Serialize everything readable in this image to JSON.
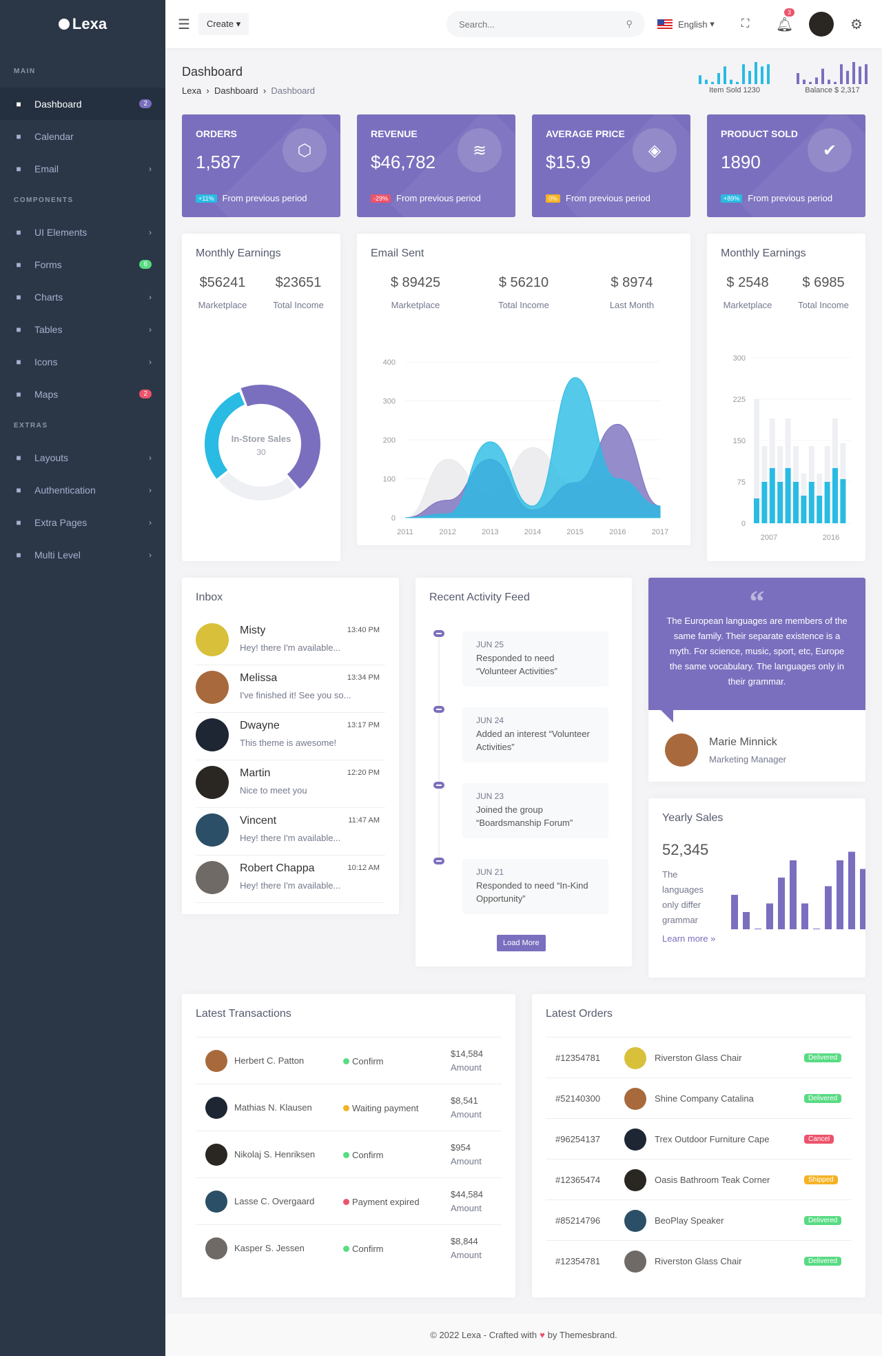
{
  "brand": {
    "name": "Lexa"
  },
  "sidebar": {
    "sections": [
      "MAIN",
      "COMPONENTS",
      "EXTRAS"
    ],
    "items": [
      {
        "label": "Dashboard",
        "icon": "dashboard-icon",
        "badge": "2",
        "badge_color": "#7a6fbe",
        "active": true
      },
      {
        "label": "Calendar",
        "icon": "calendar-icon"
      },
      {
        "label": "Email",
        "icon": "email-icon",
        "chevron": true
      },
      {
        "label": "UI Elements",
        "icon": "layers-icon",
        "chevron": true
      },
      {
        "label": "Forms",
        "icon": "clipboard-icon",
        "badge": "6",
        "badge_color": "#58db83"
      },
      {
        "label": "Charts",
        "icon": "chart-line-icon",
        "chevron": true
      },
      {
        "label": "Tables",
        "icon": "list-icon",
        "chevron": true
      },
      {
        "label": "Icons",
        "icon": "record-icon",
        "chevron": true
      },
      {
        "label": "Maps",
        "icon": "map-marker-icon",
        "badge": "2",
        "badge_color": "#ec536c"
      },
      {
        "label": "Layouts",
        "icon": "laptop-icon",
        "chevron": true
      },
      {
        "label": "Authentication",
        "icon": "account-box-icon",
        "chevron": true
      },
      {
        "label": "Extra Pages",
        "icon": "pages-icon",
        "chevron": true
      },
      {
        "label": "Multi Level",
        "icon": "share-icon",
        "chevron": true
      }
    ]
  },
  "topbar": {
    "create_label": "Create",
    "search_placeholder": "Search...",
    "language": "English",
    "notification_count": "3"
  },
  "page": {
    "title": "Dashboard",
    "breadcrumb": [
      "Lexa",
      "Dashboard",
      "Dashboard"
    ],
    "sparklines": [
      {
        "label": "Item Sold 1230",
        "color": "#29bbe3",
        "values": [
          4,
          2,
          1,
          5,
          8,
          2,
          1,
          9,
          6,
          10,
          8,
          9
        ]
      },
      {
        "label": "Balance $ 2,317",
        "color": "#7a6fbe",
        "values": [
          5,
          2,
          1,
          3,
          7,
          2,
          1,
          9,
          6,
          10,
          8,
          9
        ]
      }
    ]
  },
  "stats": [
    {
      "title": "ORDERS",
      "value": "1,587",
      "change": "+11%",
      "change_color": "#29bbe3",
      "footer": "From previous period",
      "icon": "cube-icon"
    },
    {
      "title": "REVENUE",
      "value": "$46,782",
      "change": "-29%",
      "change_color": "#ec536c",
      "footer": "From previous period",
      "icon": "layers-icon"
    },
    {
      "title": "AVERAGE PRICE",
      "value": "$15.9",
      "change": "0%",
      "change_color": "#f5b225",
      "footer": "From previous period",
      "icon": "tag-icon"
    },
    {
      "title": "PRODUCT SOLD",
      "value": "1890",
      "change": "+89%",
      "change_color": "#29bbe3",
      "footer": "From previous period",
      "icon": "briefcase-check-icon"
    }
  ],
  "earnings1": {
    "title": "Monthly Earnings",
    "kpis": [
      {
        "value": "$56241",
        "label": "Marketplace"
      },
      {
        "value": "$23651",
        "label": "Total Income"
      }
    ],
    "donut_label": "In-Store Sales",
    "donut_value": "30"
  },
  "email": {
    "title": "Email Sent",
    "kpis": [
      {
        "value": "$ 89425",
        "label": "Marketplace"
      },
      {
        "value": "$ 56210",
        "label": "Total Income"
      },
      {
        "value": "$ 8974",
        "label": "Last Month"
      }
    ]
  },
  "earnings2": {
    "title": "Monthly Earnings",
    "kpis": [
      {
        "value": "$ 2548",
        "label": "Marketplace"
      },
      {
        "value": "$ 6985",
        "label": "Total Income"
      }
    ]
  },
  "chart_data": [
    {
      "type": "pie",
      "variant": "donut",
      "title": "In-Store Sales",
      "slices": [
        {
          "value": 45,
          "color": "#7a6fbe"
        },
        {
          "value": 25,
          "color": "#eef0f4"
        },
        {
          "value": 30,
          "color": "#29bbe3"
        }
      ]
    },
    {
      "type": "area",
      "x": [
        "2011",
        "2012",
        "2013",
        "2014",
        "2015",
        "2016",
        "2017"
      ],
      "ylim": [
        0,
        400
      ],
      "yticks": [
        0,
        100,
        200,
        300,
        400
      ],
      "series": [
        {
          "color": "#e8e8ec",
          "values": [
            0,
            150,
            60,
            180,
            80,
            100,
            30
          ]
        },
        {
          "color": "#7a6fbe",
          "values": [
            0,
            45,
            150,
            20,
            90,
            240,
            30
          ]
        },
        {
          "color": "#29bbe3",
          "values": [
            0,
            10,
            195,
            30,
            360,
            100,
            30
          ]
        }
      ]
    },
    {
      "type": "bar",
      "ylim": [
        0,
        300
      ],
      "yticks": [
        0,
        75,
        150,
        225,
        300
      ],
      "xticks": [
        "2007",
        "2016"
      ],
      "series": [
        {
          "color": "#eef0f4",
          "values": [
            225,
            140,
            190,
            140,
            190,
            140,
            90,
            140,
            90,
            140,
            190,
            145
          ]
        },
        {
          "color": "#29bbe3",
          "values": [
            45,
            75,
            100,
            75,
            100,
            75,
            50,
            75,
            50,
            75,
            100,
            80
          ]
        }
      ]
    },
    {
      "type": "bar",
      "title": "Yearly Sales",
      "values": [
        4,
        2,
        0,
        3,
        6,
        8,
        3,
        0,
        5,
        8,
        9,
        7,
        8
      ],
      "color": "#7a6fbe"
    }
  ],
  "inbox": {
    "title": "Inbox",
    "messages": [
      {
        "name": "Misty",
        "text": "Hey! there I'm available...",
        "time": "13:40 PM",
        "color": "#d8c03a"
      },
      {
        "name": "Melissa",
        "text": "I've finished it! See you so...",
        "time": "13:34 PM",
        "color": "#a86a3c"
      },
      {
        "name": "Dwayne",
        "text": "This theme is awesome!",
        "time": "13:17 PM",
        "color": "#1e2633"
      },
      {
        "name": "Martin",
        "text": "Nice to meet you",
        "time": "12:20 PM",
        "color": "#2a2622"
      },
      {
        "name": "Vincent",
        "text": "Hey! there I'm available...",
        "time": "11:47 AM",
        "color": "#2b4f66"
      },
      {
        "name": "Robert Chappa",
        "text": "Hey! there I'm available...",
        "time": "10:12 AM",
        "color": "#6f6a66"
      }
    ]
  },
  "activity": {
    "title": "Recent Activity Feed",
    "items": [
      {
        "date": "JUN 25",
        "text": "Responded to need “Volunteer Activities”"
      },
      {
        "date": "JUN 24",
        "text": "Added an interest “Volunteer Activities”"
      },
      {
        "date": "JUN 23",
        "text": "Joined the group “Boardsmanship Forum”"
      },
      {
        "date": "JUN 21",
        "text": "Responded to need “In-Kind Opportunity”"
      }
    ],
    "load_more": "Load More"
  },
  "testimonial": {
    "quote": "The European languages are members of the same family. Their separate existence is a myth. For science, music, sport, etc, Europe the same vocabulary. The languages only in their grammar.",
    "name": "Marie Minnick",
    "role": "Marketing Manager"
  },
  "yearly": {
    "title": "Yearly Sales",
    "value": "52,345",
    "text": "The languages only differ grammar",
    "link": "Learn more »"
  },
  "transactions": {
    "title": "Latest Transactions",
    "rows": [
      {
        "name": "Herbert C. Patton",
        "status": "Confirm",
        "status_color": "#58db83",
        "amount": "$14,584",
        "amount_label": "Amount",
        "color": "#a86a3c"
      },
      {
        "name": "Mathias N. Klausen",
        "status": "Waiting payment",
        "status_color": "#f5b225",
        "amount": "$8,541",
        "amount_label": "Amount",
        "color": "#1e2633"
      },
      {
        "name": "Nikolaj S. Henriksen",
        "status": "Confirm",
        "status_color": "#58db83",
        "amount": "$954",
        "amount_label": "Amount",
        "color": "#2a2622"
      },
      {
        "name": "Lasse C. Overgaard",
        "status": "Payment expired",
        "status_color": "#ec536c",
        "amount": "$44,584",
        "amount_label": "Amount",
        "color": "#2b4f66"
      },
      {
        "name": "Kasper S. Jessen",
        "status": "Confirm",
        "status_color": "#58db83",
        "amount": "$8,844",
        "amount_label": "Amount",
        "color": "#6f6a66"
      }
    ]
  },
  "orders": {
    "title": "Latest Orders",
    "rows": [
      {
        "id": "#12354781",
        "product": "Riverston Glass Chair",
        "status": "Delivered",
        "status_color": "#58db83",
        "color": "#d8c03a"
      },
      {
        "id": "#52140300",
        "product": "Shine Company Catalina",
        "status": "Delivered",
        "status_color": "#58db83",
        "color": "#a86a3c"
      },
      {
        "id": "#96254137",
        "product": "Trex Outdoor Furniture Cape",
        "status": "Cancel",
        "status_color": "#ec536c",
        "color": "#1e2633"
      },
      {
        "id": "#12365474",
        "product": "Oasis Bathroom Teak Corner",
        "status": "Shipped",
        "status_color": "#f5b225",
        "color": "#2a2622"
      },
      {
        "id": "#85214796",
        "product": "BeoPlay Speaker",
        "status": "Delivered",
        "status_color": "#58db83",
        "color": "#2b4f66"
      },
      {
        "id": "#12354781",
        "product": "Riverston Glass Chair",
        "status": "Delivered",
        "status_color": "#58db83",
        "color": "#6f6a66"
      }
    ]
  },
  "footer": {
    "before": "© 2022 Lexa - Crafted with",
    "after": "by Themesbrand."
  }
}
